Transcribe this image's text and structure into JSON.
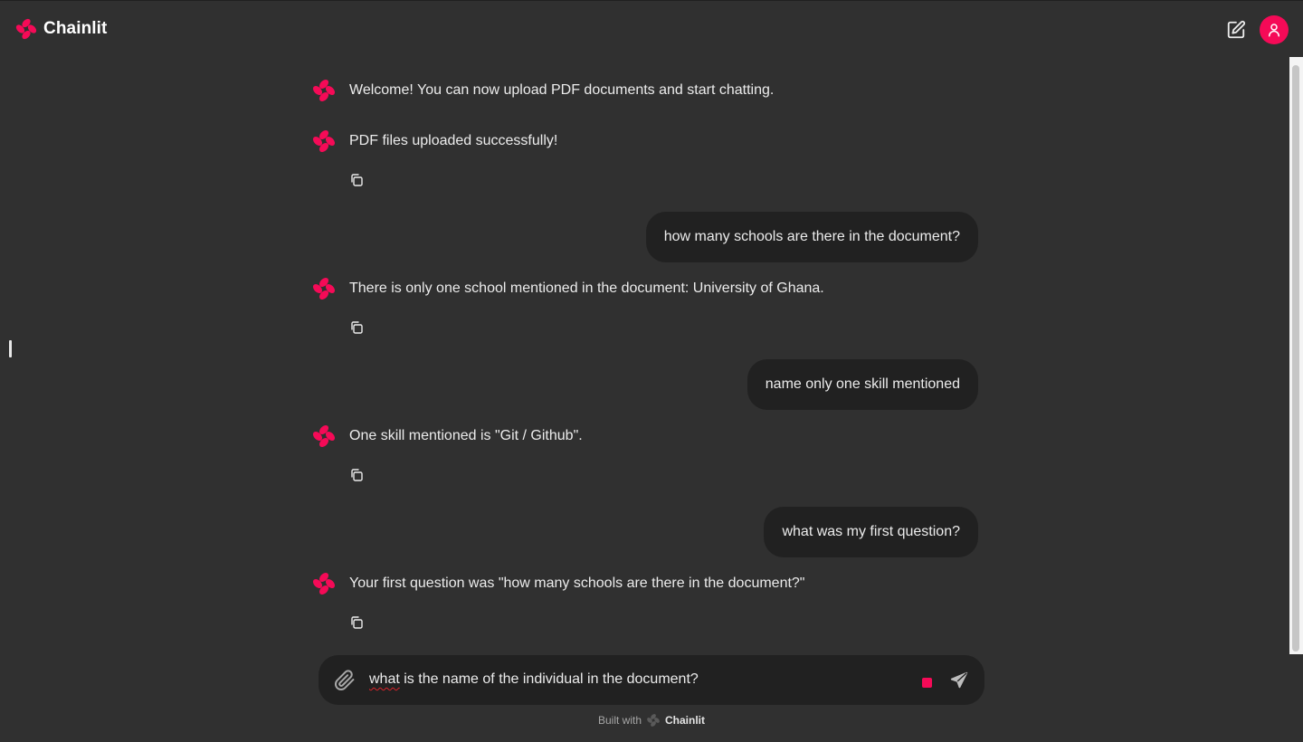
{
  "header": {
    "brand_name": "Chainlit",
    "new_chat_icon": "edit-icon",
    "user_icon": "user-icon",
    "accent_color": "#f50a57"
  },
  "messages": [
    {
      "role": "assistant",
      "text": "Welcome! You can now upload PDF documents and start chatting.",
      "copy": false
    },
    {
      "role": "assistant",
      "text": "PDF files uploaded successfully!",
      "copy": true
    },
    {
      "role": "user",
      "text": "how many schools are there in the document?"
    },
    {
      "role": "assistant",
      "text": "There is only one school mentioned in the document: University of Ghana.",
      "copy": true
    },
    {
      "role": "user",
      "text": "name only one skill mentioned"
    },
    {
      "role": "assistant",
      "text": "One skill mentioned is \"Git / Github\".",
      "copy": true
    },
    {
      "role": "user",
      "text": "what was my first question?"
    },
    {
      "role": "assistant",
      "text": "Your first question was \"how many schools are there in the document?\"",
      "copy": true
    }
  ],
  "composer": {
    "input_value_first": "what",
    "input_value_rest": " is the name of the individual in the document?",
    "attach_icon": "paperclip-icon",
    "stop_icon": "stop-icon",
    "send_icon": "send-icon"
  },
  "footer": {
    "built_with": "Built with",
    "brand": "Chainlit"
  }
}
